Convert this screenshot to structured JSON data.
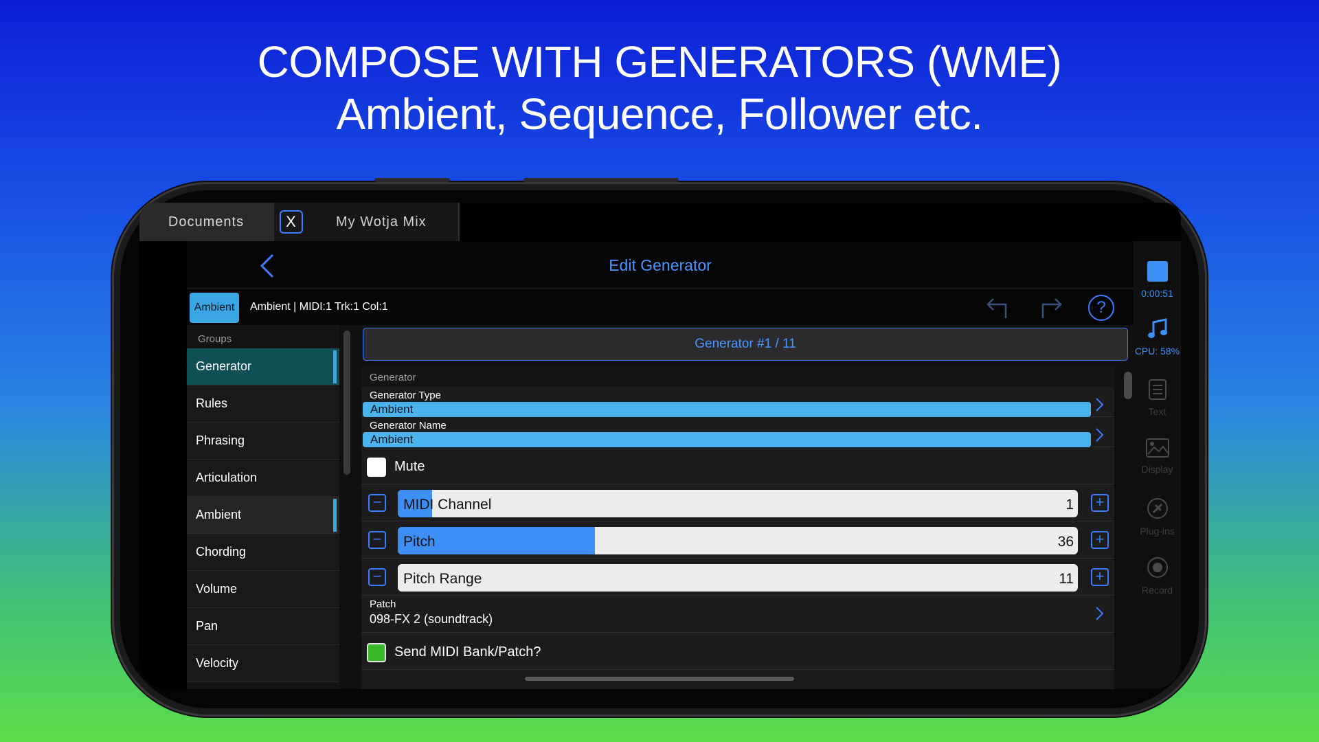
{
  "headline": {
    "line1": "COMPOSE WITH GENERATORS (WME)",
    "line2": "Ambient, Sequence, Follower etc."
  },
  "tabs": {
    "documents": "Documents",
    "close": "X",
    "document_name": "My Wotja Mix"
  },
  "nav": {
    "title": "Edit Generator"
  },
  "info": {
    "pill": "Ambient",
    "text": "Ambient | MIDI:1 Trk:1 Col:1",
    "help": "?"
  },
  "groups": {
    "label": "Groups",
    "items": [
      "Generator",
      "Rules",
      "Phrasing",
      "Articulation",
      "Ambient",
      "Chording",
      "Volume",
      "Pan",
      "Velocity"
    ]
  },
  "generator_header": "Generator #1 / 11",
  "section_label": "Generator",
  "fields": {
    "type_label": "Generator Type",
    "type_value": "Ambient",
    "name_label": "Generator Name",
    "name_value": "Ambient",
    "mute": "Mute",
    "midi_channel": {
      "label": "MIDI Channel",
      "value": "1",
      "level": 0.05
    },
    "pitch": {
      "label": "Pitch",
      "value": "36",
      "level": 0.29
    },
    "pitch_range": {
      "label": "Pitch Range",
      "value": "11",
      "level": 0.0
    },
    "patch_label": "Patch",
    "patch_value": "098-FX 2 (soundtrack)",
    "send_midi": "Send MIDI Bank/Patch?"
  },
  "right_bar": {
    "time": "0:00:51",
    "cpu": "CPU: 58%",
    "text": "Text",
    "display": "Display",
    "plugins": "Plug-ins",
    "record": "Record"
  },
  "colors": {
    "accent": "#3d7cff",
    "pill": "#4bb4ec",
    "active_group": "#0f4f56"
  }
}
